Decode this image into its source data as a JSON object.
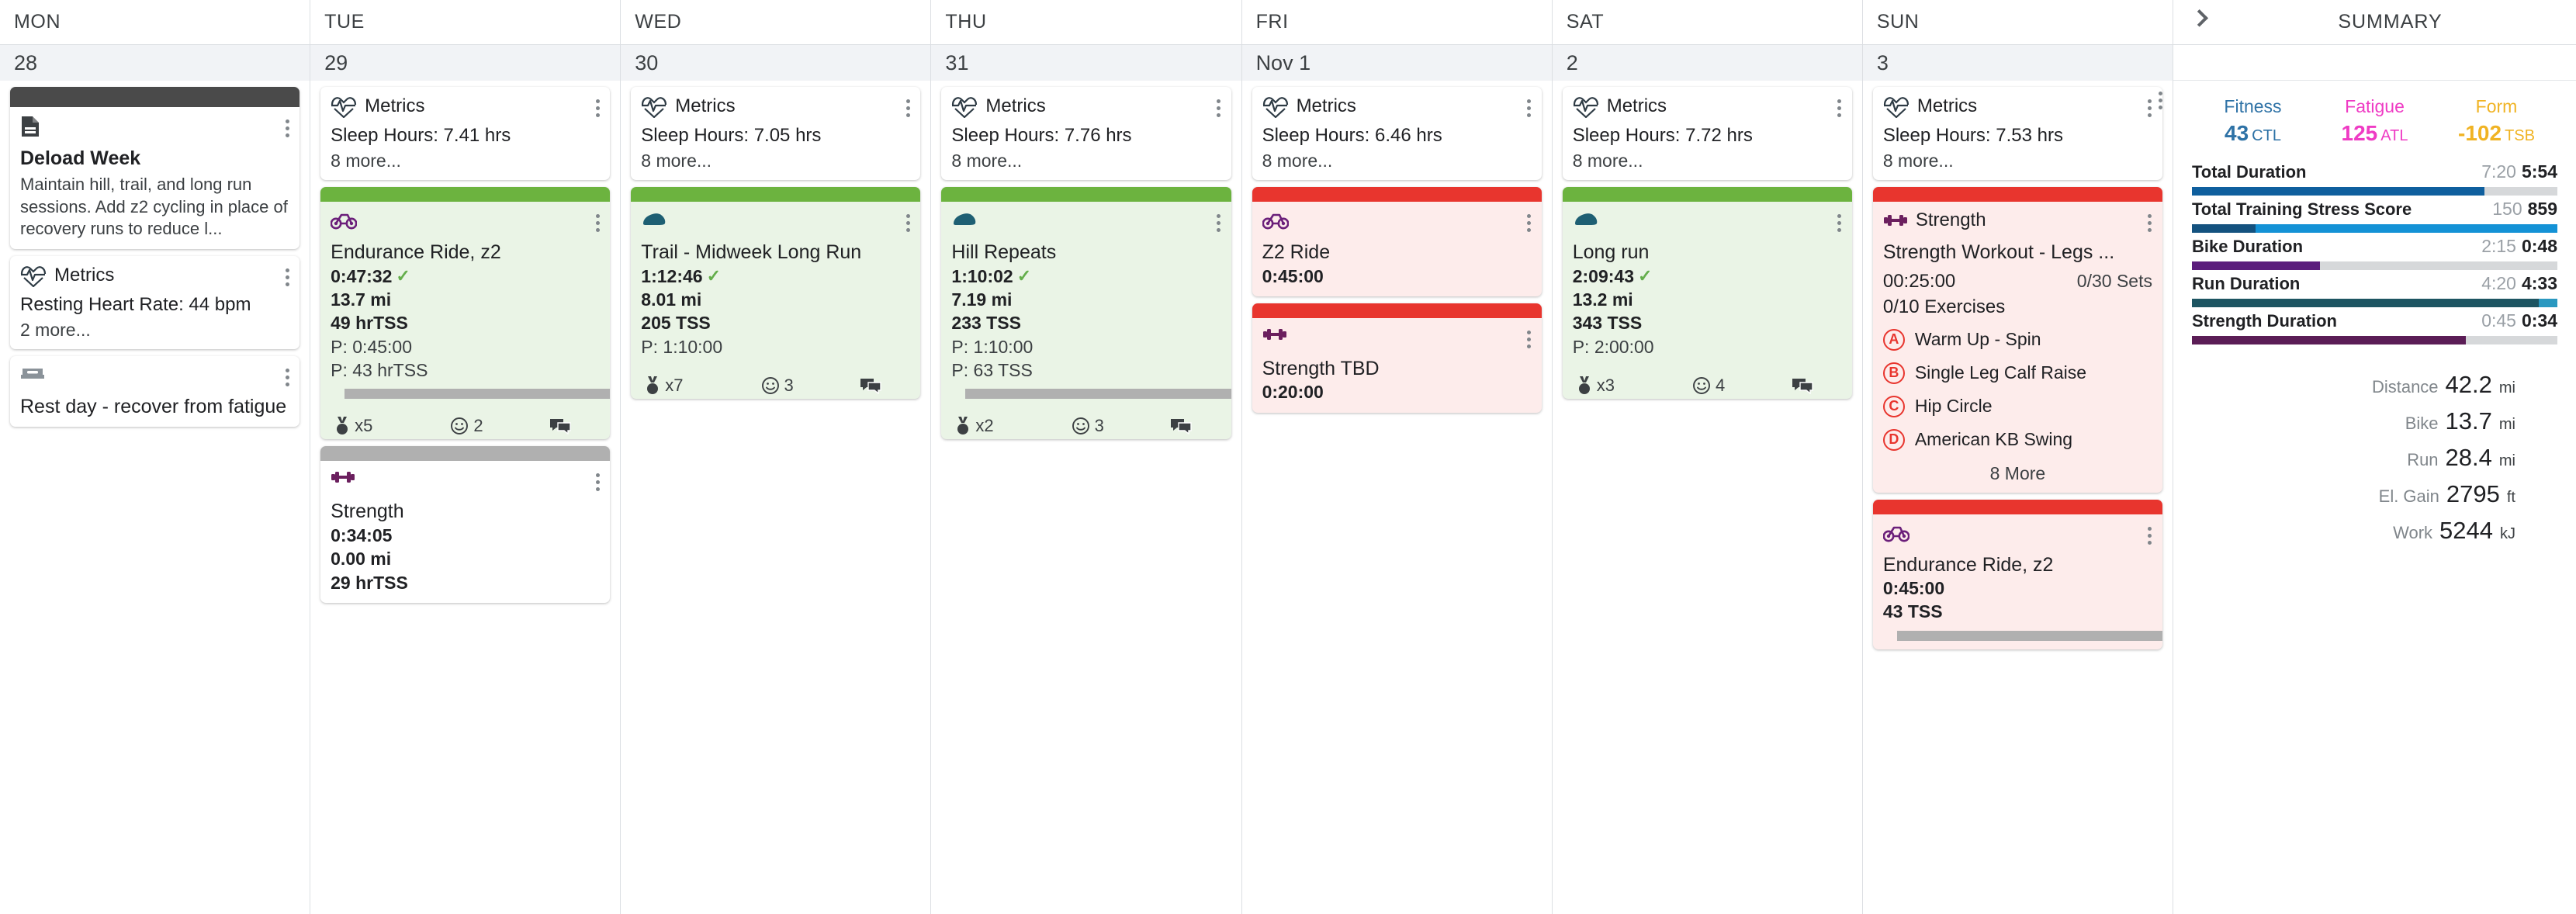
{
  "calendar": {
    "day_headers": [
      "MON",
      "TUE",
      "WED",
      "THU",
      "FRI",
      "SAT",
      "SUN"
    ],
    "days": [
      {
        "id": "mon",
        "date": "28",
        "cards": [
          {
            "kind": "note",
            "stripe": "dark",
            "icon": "document-icon",
            "title": "Deload Week",
            "body": "Maintain hill, trail, and long run sessions. Add z2 cycling in place of recovery runs to reduce l..."
          },
          {
            "kind": "metrics",
            "icon": "heart-pulse-icon",
            "header": "Metrics",
            "line": "Resting Heart Rate: 44 bpm",
            "more": "2 more..."
          },
          {
            "kind": "rest",
            "icon": "rest-day-icon",
            "title": "Rest day - recover from fatigue"
          }
        ]
      },
      {
        "id": "tue",
        "date": "29",
        "cards": [
          {
            "kind": "metrics",
            "icon": "heart-pulse-icon",
            "header": "Metrics",
            "line": "Sleep Hours: 7.41 hrs",
            "more": "8 more..."
          },
          {
            "kind": "workout",
            "stripe": "green",
            "icon": "bike-icon",
            "title": "Endurance Ride, z2",
            "actual_duration": "0:47:32",
            "completed": true,
            "distance": "13.7 mi",
            "load": "49 hrTSS",
            "planned_duration": "P: 0:45:00",
            "planned_load": "P: 43 hrTSS",
            "bars": [
              {
                "indent": true,
                "width": 100
              }
            ],
            "footer": {
              "medal": "x5",
              "smiley": "2",
              "comment": "comment-icon"
            }
          },
          {
            "kind": "workout",
            "stripe": "gray",
            "icon": "strength-icon",
            "title": "Strength",
            "actual_duration": "0:34:05",
            "completed": false,
            "distance": "0.00 mi",
            "load": "29 hrTSS"
          }
        ]
      },
      {
        "id": "wed",
        "date": "30",
        "cards": [
          {
            "kind": "metrics",
            "icon": "heart-pulse-icon",
            "header": "Metrics",
            "line": "Sleep Hours: 7.05 hrs",
            "more": "8 more..."
          },
          {
            "kind": "workout",
            "stripe": "green",
            "icon": "run-icon",
            "title": "Trail - Midweek Long Run",
            "actual_duration": "1:12:46",
            "completed": true,
            "distance": "8.01 mi",
            "load": "205 TSS",
            "planned_duration": "P: 1:10:00",
            "footer": {
              "medal": "x7",
              "smiley": "3",
              "comment": "comment-icon"
            }
          }
        ]
      },
      {
        "id": "thu",
        "date": "31",
        "cards": [
          {
            "kind": "metrics",
            "icon": "heart-pulse-icon",
            "header": "Metrics",
            "line": "Sleep Hours: 7.76 hrs",
            "more": "8 more..."
          },
          {
            "kind": "workout",
            "stripe": "green",
            "icon": "run-icon",
            "title": "Hill Repeats",
            "actual_duration": "1:10:02",
            "completed": true,
            "distance": "7.19 mi",
            "load": "233 TSS",
            "planned_duration": "P: 1:10:00",
            "planned_load": "P: 63 TSS",
            "bars": [
              {
                "indent": true,
                "width": 100
              }
            ],
            "footer": {
              "medal": "x2",
              "smiley": "3",
              "comment": "comment-icon"
            }
          }
        ]
      },
      {
        "id": "fri",
        "date": "Nov 1",
        "cards": [
          {
            "kind": "metrics",
            "icon": "heart-pulse-icon",
            "header": "Metrics",
            "line": "Sleep Hours: 6.46 hrs",
            "more": "8 more..."
          },
          {
            "kind": "workout",
            "stripe": "red",
            "icon": "bike-icon",
            "title": "Z2 Ride",
            "planned_only": "0:45:00"
          },
          {
            "kind": "workout",
            "stripe": "red",
            "icon": "strength-icon",
            "title": "Strength TBD",
            "planned_only": "0:20:00"
          }
        ]
      },
      {
        "id": "sat",
        "date": "2",
        "cards": [
          {
            "kind": "metrics",
            "icon": "heart-pulse-icon",
            "header": "Metrics",
            "line": "Sleep Hours: 7.72 hrs",
            "more": "8 more..."
          },
          {
            "kind": "workout",
            "stripe": "green",
            "icon": "run-icon",
            "title": "Long run",
            "actual_duration": "2:09:43",
            "completed": true,
            "distance": "13.2 mi",
            "load": "343 TSS",
            "planned_duration": "P: 2:00:00",
            "footer": {
              "medal": "x3",
              "smiley": "4",
              "comment": "comment-icon"
            }
          }
        ]
      },
      {
        "id": "sun",
        "date": "3",
        "cards": [
          {
            "kind": "metrics",
            "icon": "heart-pulse-icon",
            "header": "Metrics",
            "line": "Sleep Hours: 7.53 hrs",
            "more": "8 more..."
          },
          {
            "kind": "strength_detail",
            "stripe": "red",
            "icon": "strength-icon",
            "header": "Strength",
            "title": "Strength Workout - Legs ...",
            "duration": "00:25:00",
            "sets": "0/30 Sets",
            "exercise_count": "0/10 Exercises",
            "exercises": [
              {
                "badge": "A",
                "name": "Warm Up - Spin"
              },
              {
                "badge": "B",
                "name": "Single Leg Calf Raise"
              },
              {
                "badge": "C",
                "name": "Hip Circle"
              },
              {
                "badge": "D",
                "name": "American KB Swing"
              }
            ],
            "more": "8 More"
          },
          {
            "kind": "workout",
            "stripe": "red",
            "icon": "bike-icon",
            "title": "Endurance Ride, z2",
            "planned_only": "0:45:00",
            "planned_load2": "43 TSS",
            "bars": [
              {
                "indent": true,
                "width": 100
              }
            ]
          }
        ]
      }
    ]
  },
  "summary": {
    "title": "SUMMARY",
    "chevron_icon": "chevron-right-icon",
    "pmc": [
      {
        "label": "Fitness",
        "value": "43",
        "unit": "CTL",
        "color": "#2e72a6"
      },
      {
        "label": "Fatigue",
        "value": "125",
        "unit": "ATL",
        "color": "#ef3bc4"
      },
      {
        "label": "Form",
        "value": "-102",
        "unit": "TSB",
        "color": "#f0b323"
      }
    ],
    "bars": [
      {
        "name": "Total Duration",
        "planned": "7:20",
        "actual": "5:54",
        "fill": 80,
        "color": "#0f5f9e",
        "fill2": 0,
        "color2": "#0f5f9e"
      },
      {
        "name": "Total Training Stress Score",
        "planned": "150",
        "actual": "859",
        "fill": 17.5,
        "color": "#14527f",
        "fill2": 100,
        "color2": "#1492d6"
      },
      {
        "name": "Bike Duration",
        "planned": "2:15",
        "actual": "0:48",
        "fill": 35,
        "color": "#5b1d7c",
        "fill2": 0,
        "color2": "#5b1d7c"
      },
      {
        "name": "Run Duration",
        "planned": "4:20",
        "actual": "4:33",
        "fill": 95,
        "color": "#1d5562",
        "fill2": 100,
        "color2": "#2a98c0"
      },
      {
        "name": "Strength Duration",
        "planned": "0:45",
        "actual": "0:34",
        "fill": 75,
        "color": "#5b1d56",
        "fill2": 0,
        "color2": "#5b1d56"
      }
    ],
    "totals": [
      {
        "label": "Distance",
        "value": "42.2",
        "unit": "mi"
      },
      {
        "label": "Bike",
        "value": "13.7",
        "unit": "mi"
      },
      {
        "label": "Run",
        "value": "28.4",
        "unit": "mi"
      },
      {
        "label": "El. Gain",
        "value": "2795",
        "unit": "ft"
      },
      {
        "label": "Work",
        "value": "5244",
        "unit": "kJ"
      }
    ]
  }
}
